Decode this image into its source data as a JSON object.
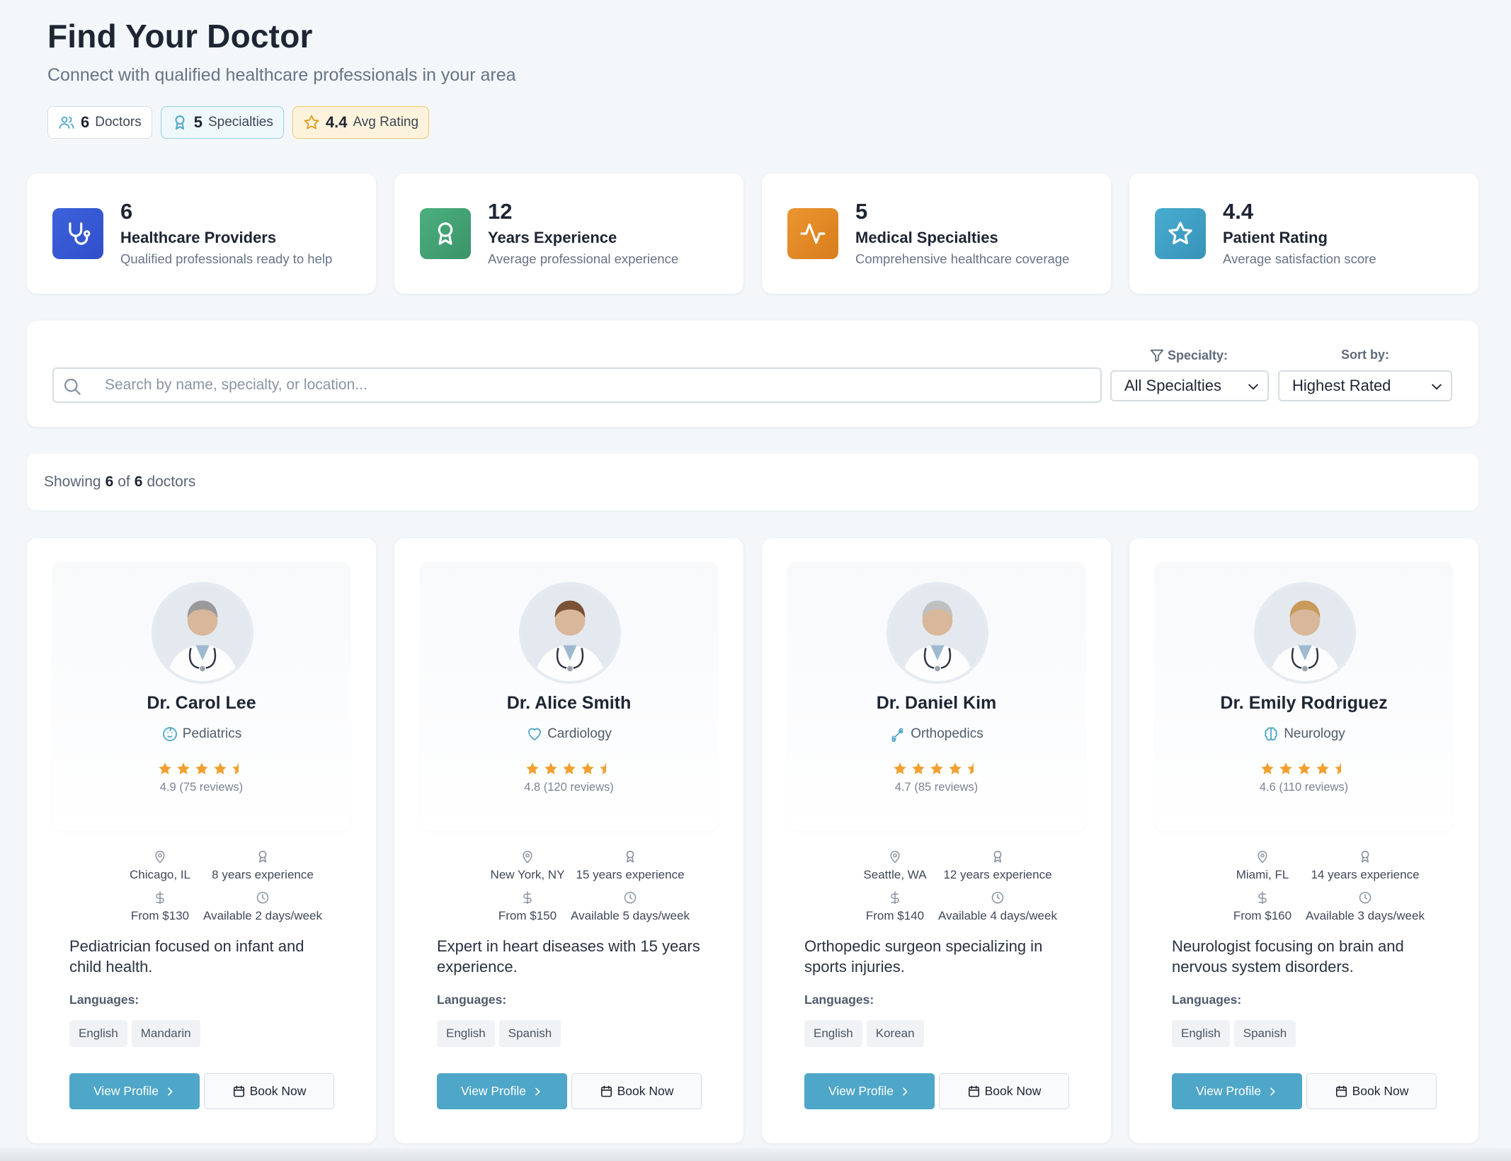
{
  "header": {
    "title": "Find Your Doctor",
    "subtitle": "Connect with qualified healthcare professionals in your area",
    "pills": [
      {
        "value": "6",
        "label": "Doctors",
        "icon": "users-icon"
      },
      {
        "value": "5",
        "label": "Specialties",
        "icon": "award-icon"
      },
      {
        "value": "4.4",
        "label": "Avg Rating",
        "icon": "star-icon"
      }
    ]
  },
  "stats": [
    {
      "value": "6",
      "label": "Healthcare Providers",
      "desc": "Qualified professionals ready to help",
      "icon": "stethoscope-icon",
      "color": "#3457d5"
    },
    {
      "value": "12",
      "label": "Years Experience",
      "desc": "Average professional experience",
      "icon": "award-icon",
      "color": "#3f9e6f"
    },
    {
      "value": "5",
      "label": "Medical Specialties",
      "desc": "Comprehensive healthcare coverage",
      "icon": "activity-icon",
      "color": "#e08a24"
    },
    {
      "value": "4.4",
      "label": "Patient Rating",
      "desc": "Average satisfaction score",
      "icon": "star-icon",
      "color": "#3b9fc3"
    }
  ],
  "search": {
    "placeholder": "Search by name, specialty, or location...",
    "specialty_label": "Specialty:",
    "specialty_value": "All Specialties",
    "sort_label": "Sort by:",
    "sort_value": "Highest Rated"
  },
  "results": {
    "prefix": "Showing",
    "shown": "6",
    "of": "of",
    "total": "6",
    "suffix": "doctors"
  },
  "labels": {
    "languages": "Languages:",
    "view_profile": "View Profile",
    "book_now": "Book Now"
  },
  "colors": {
    "primary": "#4ea6c8",
    "star": "#f0a030",
    "background": "#f4f7fa"
  },
  "doctors": [
    {
      "name": "Dr. Carol Lee",
      "specialty": "Pediatrics",
      "specialty_icon": "baby-icon",
      "rating_text": "4.9 (75 reviews)",
      "location": "Chicago, IL",
      "experience": "8 years experience",
      "price": "From $130",
      "availability": "Available 2 days/week",
      "description": "Pediatrician focused on infant and child health.",
      "languages": [
        "English",
        "Mandarin"
      ]
    },
    {
      "name": "Dr. Alice Smith",
      "specialty": "Cardiology",
      "specialty_icon": "heart-icon",
      "rating_text": "4.8 (120 reviews)",
      "location": "New York, NY",
      "experience": "15 years experience",
      "price": "From $150",
      "availability": "Available 5 days/week",
      "description": "Expert in heart diseases with 15 years experience.",
      "languages": [
        "English",
        "Spanish"
      ]
    },
    {
      "name": "Dr. Daniel Kim",
      "specialty": "Orthopedics",
      "specialty_icon": "bone-icon",
      "rating_text": "4.7 (85 reviews)",
      "location": "Seattle, WA",
      "experience": "12 years experience",
      "price": "From $140",
      "availability": "Available 4 days/week",
      "description": "Orthopedic surgeon specializing in sports injuries.",
      "languages": [
        "English",
        "Korean"
      ]
    },
    {
      "name": "Dr. Emily Rodriguez",
      "specialty": "Neurology",
      "specialty_icon": "brain-icon",
      "rating_text": "4.6 (110 reviews)",
      "location": "Miami, FL",
      "experience": "14 years experience",
      "price": "From $160",
      "availability": "Available 3 days/week",
      "description": "Neurologist focusing on brain and nervous system disorders.",
      "languages": [
        "English",
        "Spanish"
      ]
    }
  ]
}
